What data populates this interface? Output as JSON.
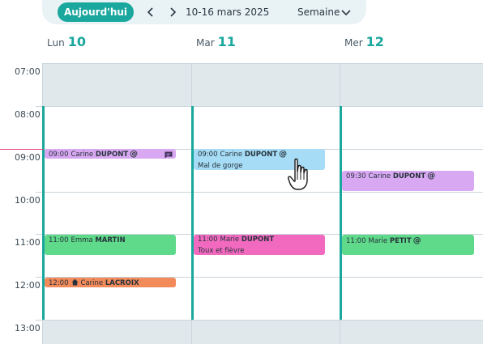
{
  "toolbar": {
    "today_label": "Aujourd'hui",
    "prev_icon": "chevron-left-icon",
    "next_icon": "chevron-right-icon",
    "date_range": "10-16 mars 2025",
    "view_label": "Semaine",
    "view_icon": "chevron-down-icon",
    "accent": "#1aa79d"
  },
  "days": [
    {
      "name": "Lun",
      "num": "10"
    },
    {
      "name": "Mar",
      "num": "11"
    },
    {
      "name": "Mer",
      "num": "12"
    }
  ],
  "hours": [
    "07:00",
    "08:00",
    "09:00",
    "10:00",
    "11:00",
    "12:00",
    "13:00"
  ],
  "events": [
    {
      "time": "09:00",
      "first": "Carine",
      "last": "DUPONT",
      "at": "@",
      "sub": "",
      "icon": "chat-icon",
      "color": "#d8a8f2"
    },
    {
      "time": "12:00",
      "first": "Carine",
      "last": "LACROIX",
      "at": "",
      "sub": "",
      "icon": "home-icon",
      "color": "#f28a5a"
    },
    {
      "time": "11:00",
      "first": "Emma",
      "last": "MARTIN",
      "at": "",
      "sub": "",
      "icon": "",
      "color": "#5fd98a"
    },
    {
      "time": "09:00",
      "first": "Carine",
      "last": "DUPONT",
      "at": "@",
      "sub": "Mal de gorge",
      "icon": "",
      "color": "#a6dcf5"
    },
    {
      "time": "11:00",
      "first": "Marie",
      "last": "DUPONT",
      "at": "",
      "sub": "Toux et fièvre",
      "icon": "",
      "color": "#f26ac0"
    },
    {
      "time": "09:30",
      "first": "Carine",
      "last": "DUPONT",
      "at": "@",
      "sub": "",
      "icon": "",
      "color": "#d8a8f2"
    },
    {
      "time": "11:00",
      "first": "Marie",
      "last": "PETIT",
      "at": "@",
      "sub": "",
      "icon": "",
      "color": "#5fd98a"
    }
  ],
  "colors": {
    "unavailable": "#e1e8eb",
    "grid": "#c9d5dc",
    "now_line": "#e8457a"
  },
  "cursor_icon": "hand-pointer-icon"
}
